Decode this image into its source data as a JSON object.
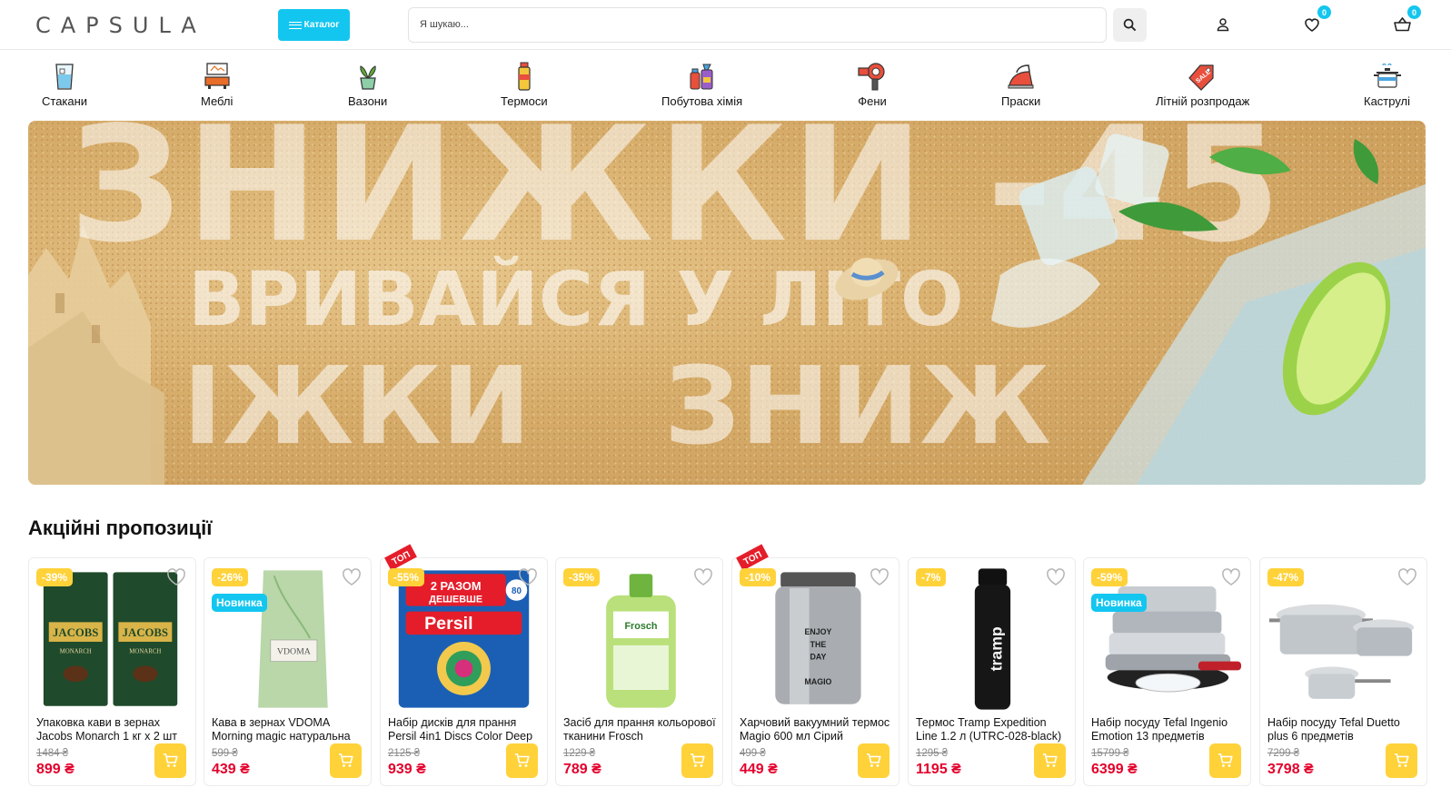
{
  "header": {
    "logo": "CAPSULA",
    "catalog_label": "Каталог",
    "search_placeholder": "Я шукаю...",
    "wishlist_count": "0",
    "cart_count": "0"
  },
  "categories": [
    {
      "label": "Стакани",
      "icon": "glass-icon"
    },
    {
      "label": "Меблі",
      "icon": "furniture-icon"
    },
    {
      "label": "Вазони",
      "icon": "flowerpot-icon"
    },
    {
      "label": "Термоси",
      "icon": "thermos-icon"
    },
    {
      "label": "Побутова хімія",
      "icon": "cleaning-icon"
    },
    {
      "label": "Фени",
      "icon": "hairdryer-icon"
    },
    {
      "label": "Праски",
      "icon": "iron-icon"
    },
    {
      "label": "Літній розпродаж",
      "icon": "sale-tag-icon"
    },
    {
      "label": "Каструлі",
      "icon": "pot-icon"
    }
  ],
  "banner": {
    "line1": "ЗНИЖКИ -45",
    "line2": "ВРИВАЙСЯ У ЛІТО",
    "line3a": "ІЖКИ",
    "line3b": "ЗНИЖ"
  },
  "promo": {
    "title": "Акційні пропозиції",
    "currency": "₴",
    "products": [
      {
        "discount": "-39%",
        "new": "",
        "top": false,
        "name": "Упаковка кави в зернах Jacobs Monarch 1 кг х 2 шт",
        "old_price": "1484 ₴",
        "price": "899 ₴"
      },
      {
        "discount": "-26%",
        "new": "Новинка",
        "top": false,
        "name": "Кава в зернах VDOMA Morning magic натуральна",
        "old_price": "599 ₴",
        "price": "439 ₴"
      },
      {
        "discount": "-55%",
        "new": "",
        "top": true,
        "top_label": "ТОП",
        "name": "Набір дисків для прання Persil 4in1 Discs Color Deep",
        "old_price": "2125 ₴",
        "price": "939 ₴"
      },
      {
        "discount": "-35%",
        "new": "",
        "top": false,
        "name": "Засіб для прання кольорової тканини Frosch",
        "old_price": "1229 ₴",
        "price": "789 ₴"
      },
      {
        "discount": "-10%",
        "new": "",
        "top": true,
        "top_label": "ТОП",
        "name": "Харчовий вакуумний термос Magio 600 мл Сірий",
        "old_price": "499 ₴",
        "price": "449 ₴"
      },
      {
        "discount": "-7%",
        "new": "",
        "top": false,
        "name": "Термос Tramp Expedition Line 1.2 л (UTRC-028-black)",
        "old_price": "1295 ₴",
        "price": "1195 ₴"
      },
      {
        "discount": "-59%",
        "new": "Новинка",
        "top": false,
        "name": "Набір посуду Tefal Ingenio Emotion 13 предметів",
        "old_price": "15799 ₴",
        "price": "6399 ₴"
      },
      {
        "discount": "-47%",
        "new": "",
        "top": false,
        "name": "Набір посуду Tefal Duetto plus 6 предметів",
        "old_price": "7299 ₴",
        "price": "3798 ₴"
      }
    ]
  },
  "colors": {
    "accent": "#13c6f0",
    "badge": "#ffd23a",
    "price": "#e4002b"
  }
}
